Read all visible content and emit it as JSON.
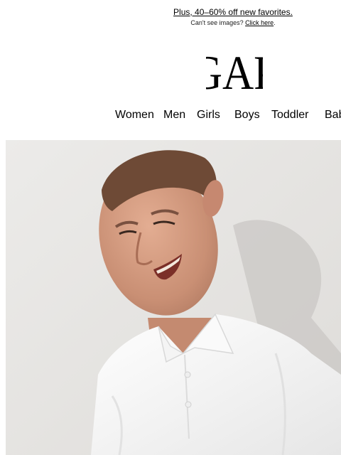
{
  "promo": {
    "headline": "Plus, 40–60% off new favorites.",
    "preheader_text": "Can't see images? ",
    "preheader_link": "Click here",
    "preheader_end": "."
  },
  "brand": {
    "logo_text": "GAP"
  },
  "nav": {
    "items": [
      {
        "label": "Women"
      },
      {
        "label": "Men"
      },
      {
        "label": "Girls"
      },
      {
        "label": "Boys"
      },
      {
        "label": "Toddler"
      },
      {
        "label": "Bab"
      }
    ]
  },
  "hero": {
    "image": "hero-photo-smiling-man-white-polo"
  },
  "colors": {
    "background": "#ffffff",
    "text": "#000000",
    "hero_backdrop": "#e9e8e6"
  }
}
